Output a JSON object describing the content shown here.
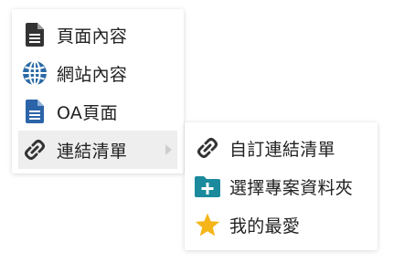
{
  "main_menu": {
    "items": [
      {
        "label": "頁面內容",
        "icon": "document-icon"
      },
      {
        "label": "網站內容",
        "icon": "globe-icon"
      },
      {
        "label": "OA頁面",
        "icon": "blue-document-icon"
      },
      {
        "label": "連結清單",
        "icon": "link-icon",
        "has_submenu": true
      }
    ]
  },
  "sub_menu": {
    "items": [
      {
        "label": "自訂連結清單",
        "icon": "link-icon"
      },
      {
        "label": "選擇專案資料夾",
        "icon": "folder-plus-icon"
      },
      {
        "label": "我的最愛",
        "icon": "star-icon"
      }
    ]
  },
  "colors": {
    "hover_background": "#eeeeee",
    "document_dark": "#333333",
    "document_blue": "#2b64a8",
    "globe_blue": "#2a6aa6",
    "folder_teal": "#1a8a9c",
    "star_gold": "#f5b519",
    "text": "#222222"
  }
}
